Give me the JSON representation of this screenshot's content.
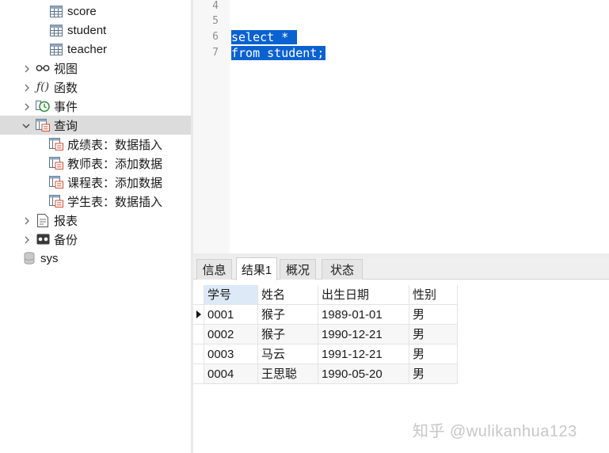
{
  "sidebar": {
    "tables": [
      {
        "label": "score",
        "icon": "table-icon"
      },
      {
        "label": "student",
        "icon": "table-icon"
      },
      {
        "label": "teacher",
        "icon": "table-icon"
      }
    ],
    "groups": [
      {
        "label": "视图",
        "icon": "view-glasses-icon",
        "expanded": false
      },
      {
        "label": "函数",
        "icon": "function-icon",
        "expanded": false
      },
      {
        "label": "事件",
        "icon": "event-clock-icon",
        "expanded": false
      },
      {
        "label": "查询",
        "icon": "query-icon",
        "expanded": true,
        "selected": true
      }
    ],
    "queries": [
      {
        "label": "成绩表：数据插入",
        "icon": "query-item-icon"
      },
      {
        "label": "教师表：添加数据",
        "icon": "query-item-icon"
      },
      {
        "label": "课程表：添加数据",
        "icon": "query-item-icon"
      },
      {
        "label": "学生表：数据插入",
        "icon": "query-item-icon"
      }
    ],
    "more_groups": [
      {
        "label": "报表",
        "icon": "report-icon",
        "expanded": false
      },
      {
        "label": "备份",
        "icon": "backup-icon",
        "expanded": false
      }
    ],
    "database": {
      "label": "sys",
      "icon": "database-icon"
    }
  },
  "editor": {
    "lines": [
      {
        "no": "4",
        "code": ""
      },
      {
        "no": "5",
        "code": ""
      },
      {
        "no": "6",
        "code": "select * "
      },
      {
        "no": "7",
        "code": "from student;"
      }
    ],
    "selection_color": "#0a62d2"
  },
  "results": {
    "tabs": [
      {
        "label": "信息",
        "active": false
      },
      {
        "label": "结果1",
        "active": true
      },
      {
        "label": "概况",
        "active": false
      },
      {
        "label": "状态",
        "active": false
      }
    ],
    "columns": [
      "学号",
      "姓名",
      "出生日期",
      "性别"
    ],
    "rows": [
      [
        "0001",
        "猴子",
        "1989-01-01",
        "男"
      ],
      [
        "0002",
        "猴子",
        "1990-12-21",
        "男"
      ],
      [
        "0003",
        "马云",
        "1991-12-21",
        "男"
      ],
      [
        "0004",
        "王思聪",
        "1990-05-20",
        "男"
      ]
    ],
    "current_row": 0
  },
  "watermark": "知乎 @wulikanhua123"
}
